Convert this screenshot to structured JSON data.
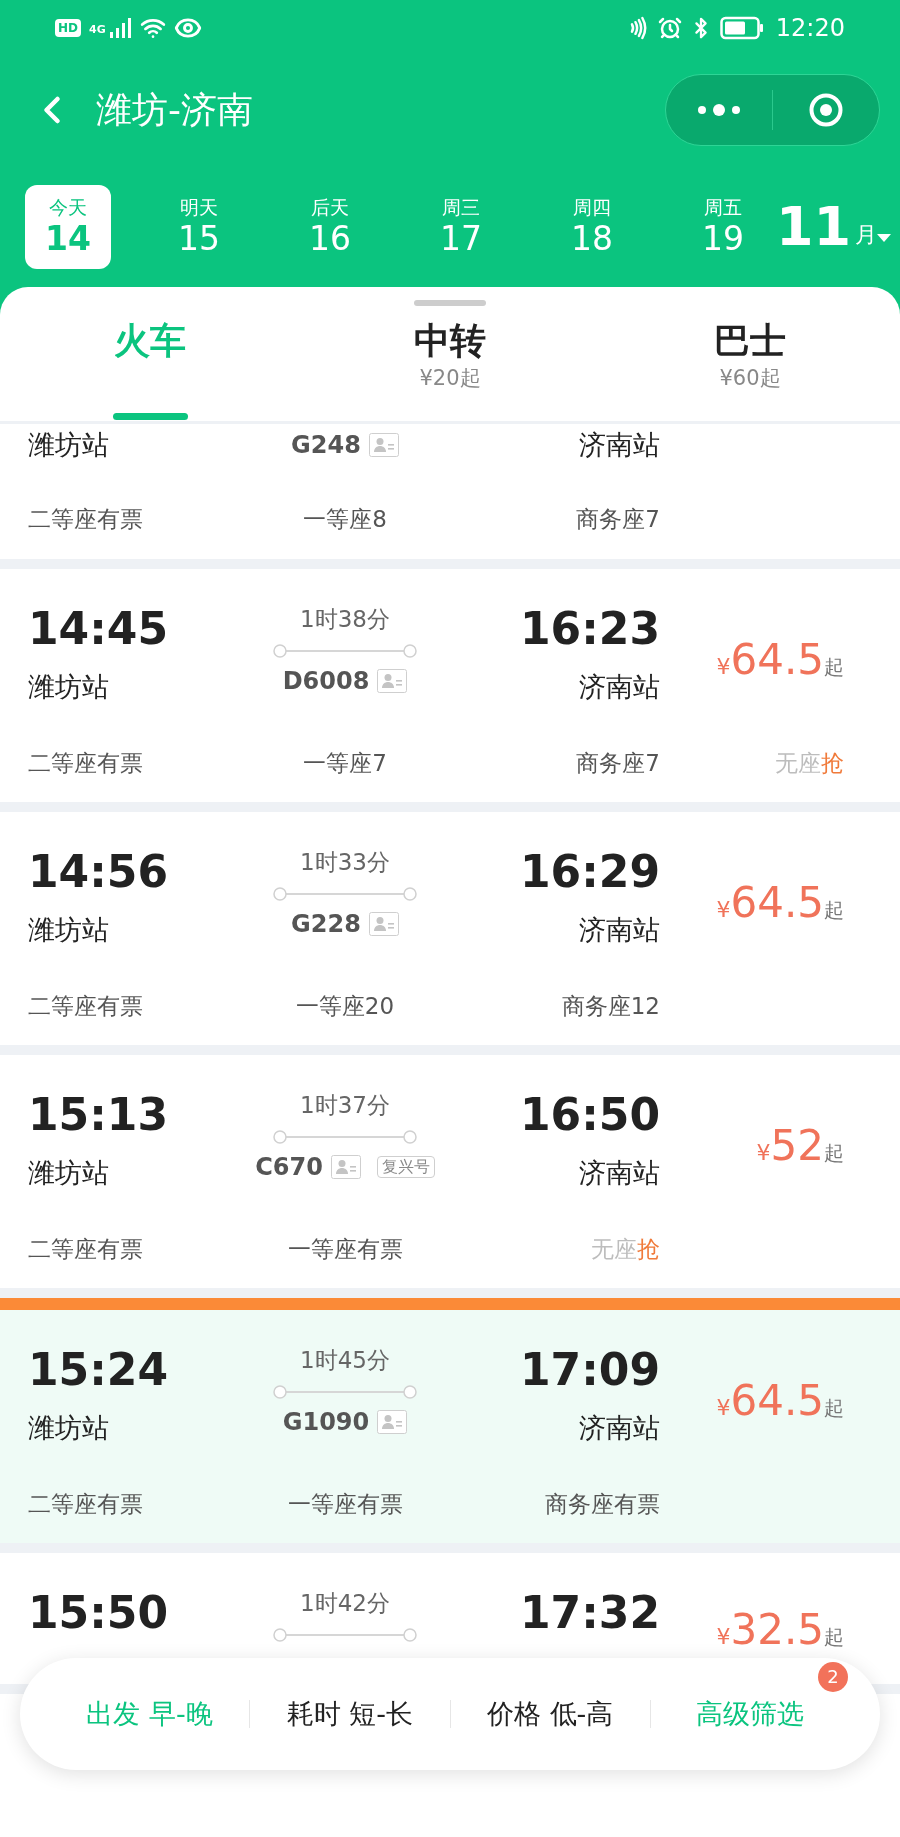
{
  "status_bar": {
    "hd": "HD",
    "network": "4G",
    "time": "12:20"
  },
  "header": {
    "title": "潍坊-济南"
  },
  "dates": [
    {
      "label": "今天",
      "day": "14",
      "selected": true
    },
    {
      "label": "明天",
      "day": "15",
      "selected": false
    },
    {
      "label": "后天",
      "day": "16",
      "selected": false
    },
    {
      "label": "周三",
      "day": "17",
      "selected": false
    },
    {
      "label": "周四",
      "day": "18",
      "selected": false
    },
    {
      "label": "周五",
      "day": "19",
      "selected": false
    }
  ],
  "month": {
    "number": "11",
    "unit": "月"
  },
  "modes": [
    {
      "label": "火车",
      "selected": true
    },
    {
      "label": "中转",
      "sub": "¥20起",
      "selected": false
    },
    {
      "label": "巴士",
      "sub": "¥60起",
      "selected": false
    }
  ],
  "trains": [
    {
      "depart_station": "潍坊站",
      "train_no": "G248",
      "arrive_station": "济南站",
      "highlighted": false,
      "seats": [
        {
          "kind": "plain",
          "text": "二等座有票"
        },
        {
          "kind": "plain",
          "text": "一等座8"
        },
        {
          "kind": "plain",
          "text": "商务座7"
        }
      ]
    },
    {
      "depart_time": "14:45",
      "depart_station": "潍坊站",
      "duration": "1时38分",
      "train_no": "D6008",
      "arrive_time": "16:23",
      "arrive_station": "济南站",
      "price": {
        "currency": "¥",
        "amount": "64.5",
        "suffix": "起"
      },
      "highlighted": false,
      "seats": [
        {
          "kind": "plain",
          "text": "二等座有票"
        },
        {
          "kind": "plain",
          "text": "一等座7"
        },
        {
          "kind": "plain",
          "text": "商务座7"
        },
        {
          "kind": "grab",
          "text": "无座",
          "action": "抢"
        }
      ]
    },
    {
      "depart_time": "14:56",
      "depart_station": "潍坊站",
      "duration": "1时33分",
      "train_no": "G228",
      "arrive_time": "16:29",
      "arrive_station": "济南站",
      "price": {
        "currency": "¥",
        "amount": "64.5",
        "suffix": "起"
      },
      "highlighted": false,
      "seats": [
        {
          "kind": "plain",
          "text": "二等座有票"
        },
        {
          "kind": "plain",
          "text": "一等座20"
        },
        {
          "kind": "plain",
          "text": "商务座12"
        }
      ]
    },
    {
      "depart_time": "15:13",
      "depart_station": "潍坊站",
      "duration": "1时37分",
      "train_no": "C670",
      "tag": "复兴号",
      "arrive_time": "16:50",
      "arrive_station": "济南站",
      "price": {
        "currency": "¥",
        "amount": "52",
        "suffix": "起"
      },
      "highlighted": false,
      "seats": [
        {
          "kind": "plain",
          "text": "二等座有票"
        },
        {
          "kind": "plain",
          "text": "一等座有票"
        },
        {
          "kind": "grab",
          "text": "无座",
          "action": "抢"
        }
      ]
    },
    {
      "depart_time": "15:24",
      "depart_station": "潍坊站",
      "duration": "1时45分",
      "train_no": "G1090",
      "arrive_time": "17:09",
      "arrive_station": "济南站",
      "price": {
        "currency": "¥",
        "amount": "64.5",
        "suffix": "起"
      },
      "highlighted": true,
      "seats": [
        {
          "kind": "plain",
          "text": "二等座有票"
        },
        {
          "kind": "plain",
          "text": "一等座有票"
        },
        {
          "kind": "plain",
          "text": "商务座有票"
        }
      ]
    },
    {
      "depart_time": "15:50",
      "duration": "1时42分",
      "arrive_time": "17:32",
      "price": {
        "currency": "¥",
        "amount": "32.5",
        "suffix": "起"
      },
      "highlighted": false
    },
    {
      "highlighted": false
    }
  ],
  "filters": [
    {
      "label": "出发 早-晚",
      "selected": true
    },
    {
      "label": "耗时 短-长",
      "selected": false
    },
    {
      "label": "价格 低-高",
      "selected": false
    },
    {
      "label": "高级筛选",
      "selected": true,
      "badge": "2"
    }
  ]
}
